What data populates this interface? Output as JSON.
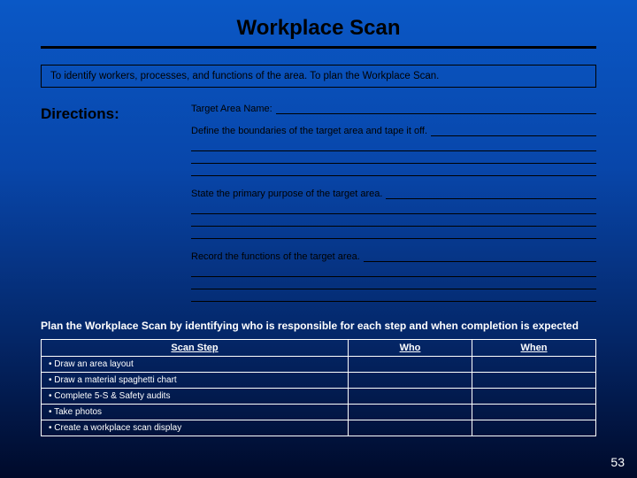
{
  "title": "Workplace Scan",
  "purpose": "To identify workers, processes, and functions of the area.  To plan the Workplace Scan.",
  "directions_label": "Directions:",
  "fields": {
    "target_area": "Target Area Name:",
    "boundaries": "Define the boundaries of the target area and tape it off.",
    "primary_purpose": "State the primary purpose of the target area.",
    "functions": "Record the functions of the target area."
  },
  "plan_heading": "Plan the Workplace Scan by identifying who is responsible for each step and when completion is expected",
  "table": {
    "headers": {
      "step": "Scan Step",
      "who": "Who",
      "when": "When"
    },
    "steps": [
      "Draw an area layout",
      "Draw a material spaghetti chart",
      "Complete 5-S & Safety audits",
      "Take photos",
      "Create a workplace scan display"
    ]
  },
  "page_number": "53"
}
